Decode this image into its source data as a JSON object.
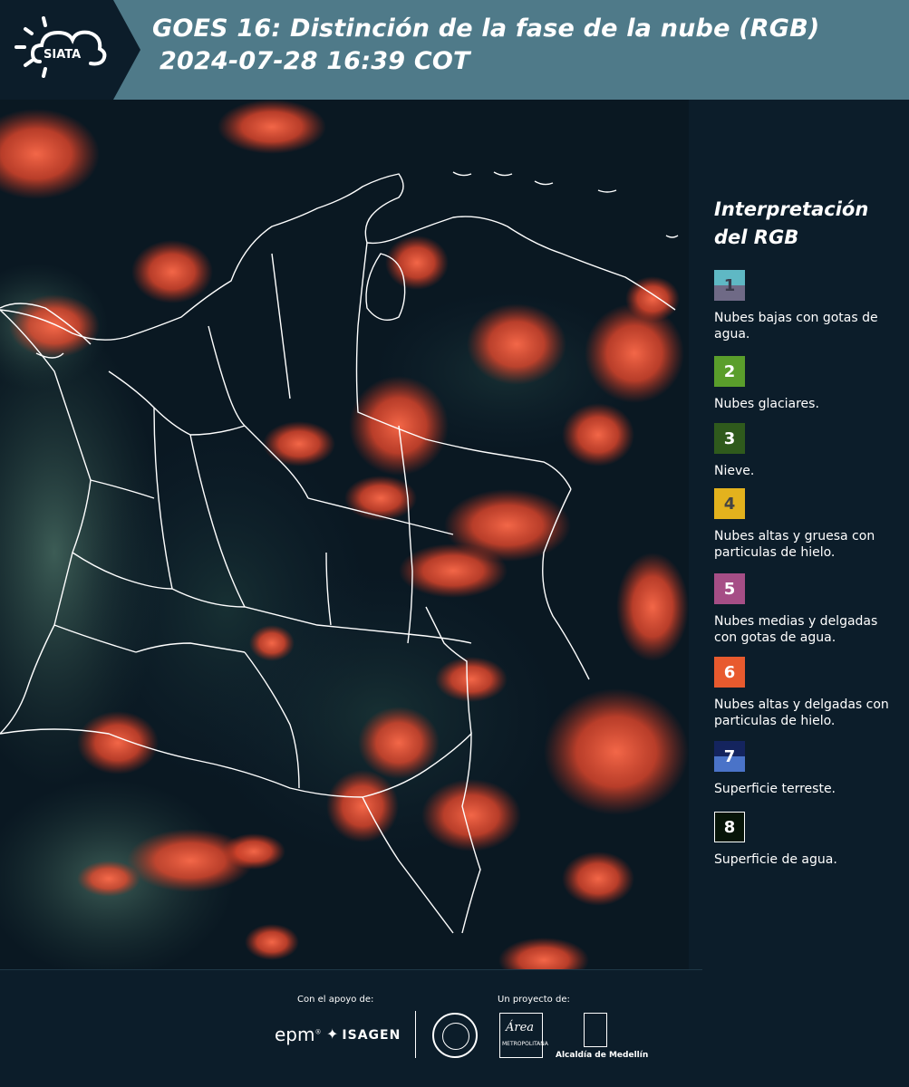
{
  "header": {
    "logo_text": "SIATA",
    "title_line1": "GOES 16: Distinción de la fase de la nube (RGB)",
    "title_line2": "2024-07-28 16:39 COT",
    "colors": {
      "background": "#4f7a89",
      "logo_block": "#0c1d2a"
    }
  },
  "map": {
    "description_icon": "satellite-rgb-cloud-phase-map",
    "colors": {
      "clouds": "#ff5a3c",
      "land": "#0f2230",
      "borders": "#ffffff"
    }
  },
  "legend": {
    "title_line1": "Interpretación",
    "title_line2": "del RGB",
    "items": [
      {
        "number": "1",
        "label": "Nubes bajas con gotas de agua.",
        "color_top": "#5fb8c4",
        "color_bottom": "#6f6a86"
      },
      {
        "number": "2",
        "label": "Nubes glaciares.",
        "color_top": "#5a9e2b",
        "color_bottom": "#5a9e2b"
      },
      {
        "number": "3",
        "label": "Nieve.",
        "color_top": "#2f5a1c",
        "color_bottom": "#2f5a1c"
      },
      {
        "number": "4",
        "label": "Nubes altas y gruesa con particulas de hielo.",
        "color_top": "#e3b21d",
        "color_bottom": "#e3b21d"
      },
      {
        "number": "5",
        "label": "Nubes medias y delgadas con gotas de agua.",
        "color_top": "#a64e86",
        "color_bottom": "#a64e86"
      },
      {
        "number": "6",
        "label": "Nubes altas y delgadas con particulas de hielo.",
        "color_top": "#e85a2e",
        "color_bottom": "#e85a2e"
      },
      {
        "number": "7",
        "label": "Superficie terreste.",
        "color_top": "#14245e",
        "color_bottom": "#4a73c8"
      },
      {
        "number": "8",
        "label": "Superficie de agua.",
        "color_top": "#071508",
        "color_bottom": "#071508"
      }
    ]
  },
  "footer": {
    "support_caption": "Con el apoyo de:",
    "project_caption": "Un proyecto de:",
    "epm_text": "epm",
    "isagen_text": "ISAGEN",
    "area_text": "Área",
    "area_subtext": "METROPOLITANA",
    "alcaldia_text": "Alcaldía de Medellín"
  }
}
